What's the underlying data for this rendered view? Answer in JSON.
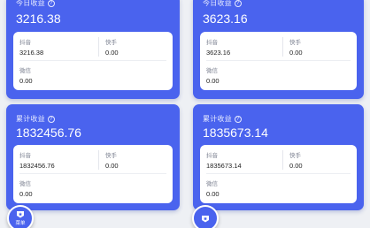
{
  "cards": [
    {
      "label": "今日收益",
      "total": "3216.38",
      "douyin_label": "抖音",
      "douyin_value": "3216.38",
      "kuaishou_label": "快手",
      "kuaishou_value": "0.00",
      "weixin_label": "微信",
      "weixin_value": "0.00"
    },
    {
      "label": "今日收益",
      "total": "3623.16",
      "douyin_label": "抖音",
      "douyin_value": "3623.16",
      "kuaishou_label": "快手",
      "kuaishou_value": "0.00",
      "weixin_label": "微信",
      "weixin_value": "0.00"
    },
    {
      "label": "累计收益",
      "total": "1832456.76",
      "douyin_label": "抖音",
      "douyin_value": "1832456.76",
      "kuaishou_label": "快手",
      "kuaishou_value": "0.00",
      "weixin_label": "微信",
      "weixin_value": "0.00"
    },
    {
      "label": "累计收益",
      "total": "1835673.14",
      "douyin_label": "抖音",
      "douyin_value": "1835673.14",
      "kuaishou_label": "快手",
      "kuaishou_value": "0.00",
      "weixin_label": "微信",
      "weixin_value": "0.00"
    }
  ],
  "help_glyph": "?",
  "fab": {
    "label": "菜单",
    "icon": "star-shield-icon"
  },
  "colors": {
    "card": "#4a63ee",
    "panel": "#ffffff",
    "background": "#eef0f4"
  }
}
